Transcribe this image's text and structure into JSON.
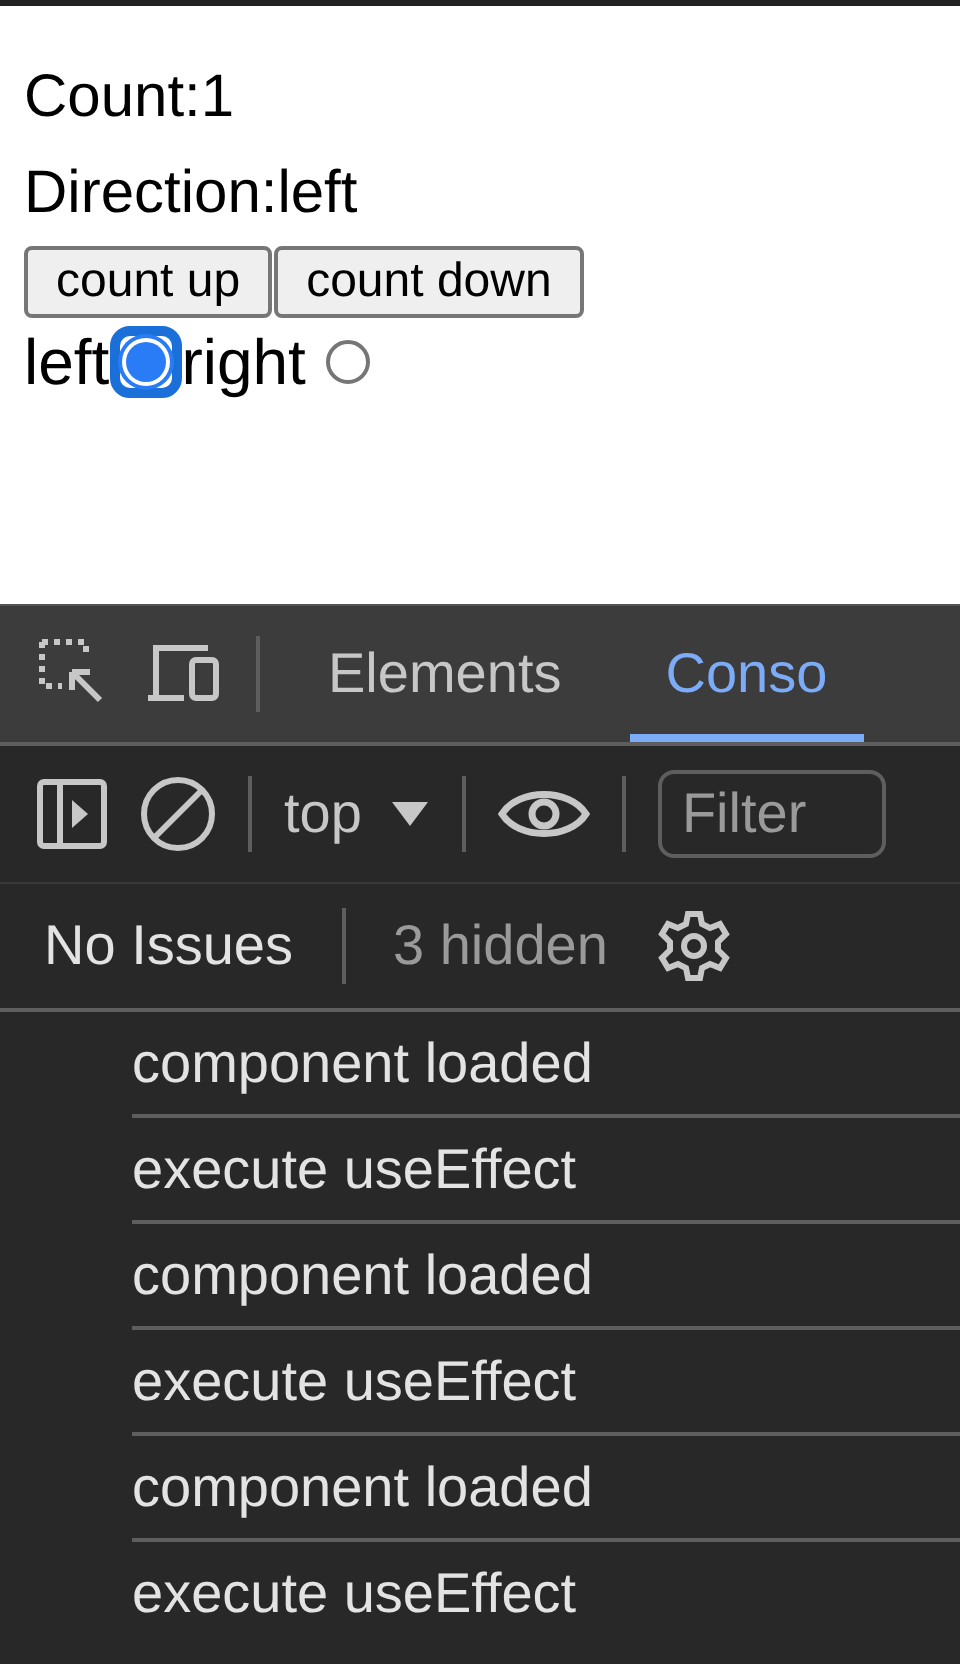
{
  "page": {
    "count_line": "Count:1",
    "direction_line": "Direction:left",
    "buttons": [
      "count up",
      "count down"
    ],
    "radios": [
      {
        "label": "left",
        "selected": true
      },
      {
        "label": "right",
        "selected": false
      }
    ]
  },
  "devtools": {
    "tabs": [
      {
        "label": "Elements",
        "selected": false
      },
      {
        "label": "Conso",
        "selected": true
      }
    ],
    "context": "top",
    "filter": {
      "placeholder": "Filter"
    },
    "issues": "No Issues",
    "hidden": "3 hidden",
    "logs": [
      "component loaded",
      "execute useEffect",
      "component loaded",
      "execute useEffect",
      "component loaded",
      "execute useEffect"
    ]
  }
}
